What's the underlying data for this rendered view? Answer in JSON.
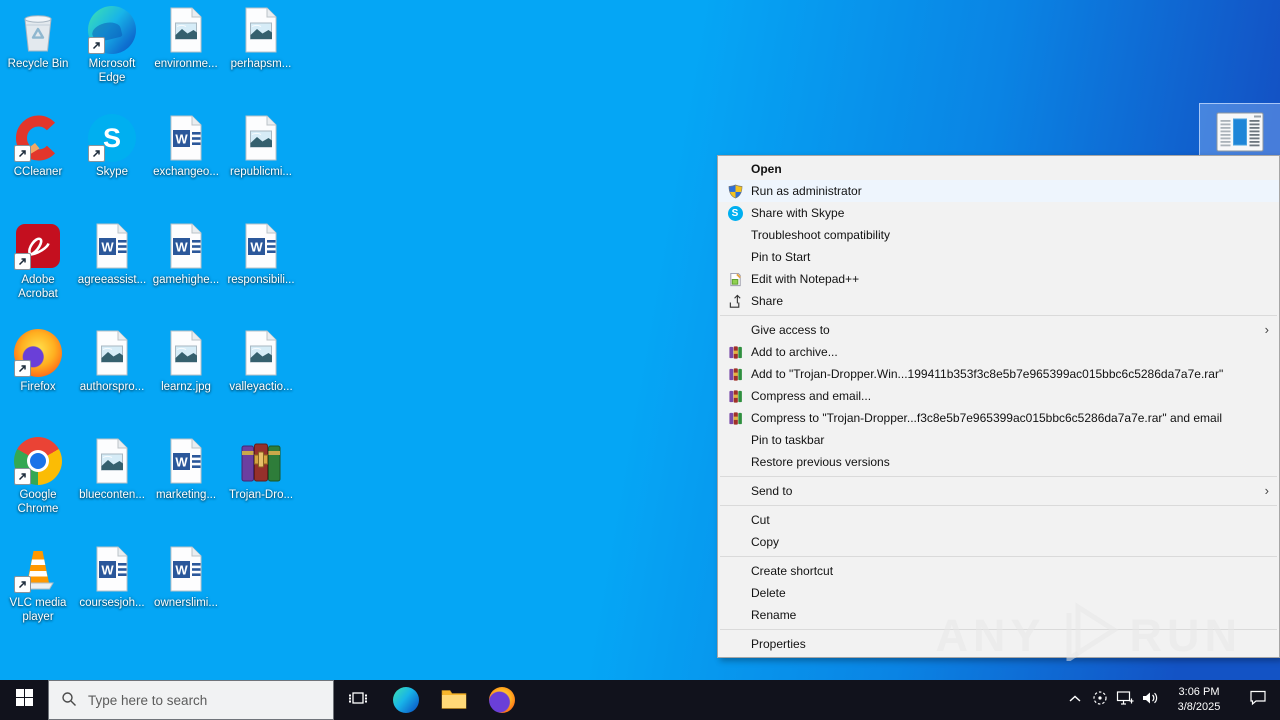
{
  "colors": {
    "wallpaper_left": "#05a6f5",
    "wallpaper_right": "#1353c5",
    "taskbar_bg": "#11121c",
    "menu_bg": "#f2f2f2",
    "menu_highlight": "#eef5fd",
    "selection_highlight": "rgba(150,190,250,0.40)",
    "skype_blue": "#00aff0",
    "word_blue": "#2b579a"
  },
  "desktop": {
    "icons": [
      {
        "label": "Recycle Bin",
        "type": "recycle-bin",
        "col": 0,
        "row": 0,
        "shortcut": false
      },
      {
        "label": "Microsoft Edge",
        "type": "edge",
        "col": 1,
        "row": 0,
        "shortcut": true
      },
      {
        "label": "environme...",
        "type": "image-file",
        "col": 2,
        "row": 0,
        "shortcut": false
      },
      {
        "label": "perhapsm...",
        "type": "image-file",
        "col": 3,
        "row": 0,
        "shortcut": false
      },
      {
        "label": "CCleaner",
        "type": "ccleaner",
        "col": 0,
        "row": 1,
        "shortcut": true
      },
      {
        "label": "Skype",
        "type": "skype",
        "col": 1,
        "row": 1,
        "shortcut": true
      },
      {
        "label": "exchangeo...",
        "type": "word-doc",
        "col": 2,
        "row": 1,
        "shortcut": false
      },
      {
        "label": "republicmi...",
        "type": "image-file",
        "col": 3,
        "row": 1,
        "shortcut": false
      },
      {
        "label": "Adobe Acrobat",
        "type": "acrobat",
        "col": 0,
        "row": 2,
        "shortcut": true
      },
      {
        "label": "agreeassist...",
        "type": "word-doc",
        "col": 1,
        "row": 2,
        "shortcut": false
      },
      {
        "label": "gamehighe...",
        "type": "word-doc",
        "col": 2,
        "row": 2,
        "shortcut": false
      },
      {
        "label": "responsibili...",
        "type": "word-doc",
        "col": 3,
        "row": 2,
        "shortcut": false
      },
      {
        "label": "Firefox",
        "type": "firefox",
        "col": 0,
        "row": 3,
        "shortcut": true
      },
      {
        "label": "authorspro...",
        "type": "image-file",
        "col": 1,
        "row": 3,
        "shortcut": false
      },
      {
        "label": "learnz.jpg",
        "type": "image-file",
        "col": 2,
        "row": 3,
        "shortcut": false
      },
      {
        "label": "valleyactio...",
        "type": "image-file",
        "col": 3,
        "row": 3,
        "shortcut": false
      },
      {
        "label": "Google Chrome",
        "type": "chrome",
        "col": 0,
        "row": 4,
        "shortcut": true
      },
      {
        "label": "blueconten...",
        "type": "image-file",
        "col": 1,
        "row": 4,
        "shortcut": false
      },
      {
        "label": "marketing...",
        "type": "word-doc",
        "col": 2,
        "row": 4,
        "shortcut": false
      },
      {
        "label": "Trojan-Dro...",
        "type": "winrar-archive",
        "col": 3,
        "row": 4,
        "shortcut": false
      },
      {
        "label": "VLC media player",
        "type": "vlc",
        "col": 0,
        "row": 5,
        "shortcut": true
      },
      {
        "label": "coursesjoh...",
        "type": "word-doc",
        "col": 1,
        "row": 5,
        "shortcut": false
      },
      {
        "label": "ownerslimi...",
        "type": "word-doc",
        "col": 2,
        "row": 5,
        "shortcut": false
      }
    ],
    "selected_file": {
      "type": "app-window"
    }
  },
  "context_menu": {
    "items": [
      {
        "label": "Open",
        "bold": true
      },
      {
        "label": "Run as administrator",
        "icon": "uac-shield-icon",
        "highlighted": true
      },
      {
        "label": "Share with Skype",
        "icon": "skype-icon"
      },
      {
        "label": "Troubleshoot compatibility"
      },
      {
        "label": "Pin to Start"
      },
      {
        "label": "Edit with Notepad++",
        "icon": "notepad-icon"
      },
      {
        "label": "Share",
        "icon": "share-icon"
      },
      {
        "separator": true
      },
      {
        "label": "Give access to",
        "submenu": true
      },
      {
        "label": "Add to archive...",
        "icon": "winrar-icon"
      },
      {
        "label": "Add to \"Trojan-Dropper.Win...199411b353f3c8e5b7e965399ac015bbc6c5286da7a7e.rar\"",
        "icon": "winrar-icon"
      },
      {
        "label": "Compress and email...",
        "icon": "winrar-icon"
      },
      {
        "label": "Compress to \"Trojan-Dropper...f3c8e5b7e965399ac015bbc6c5286da7a7e.rar\" and email",
        "icon": "winrar-icon"
      },
      {
        "label": "Pin to taskbar"
      },
      {
        "label": "Restore previous versions"
      },
      {
        "separator": true
      },
      {
        "label": "Send to",
        "submenu": true
      },
      {
        "separator": true
      },
      {
        "label": "Cut"
      },
      {
        "label": "Copy"
      },
      {
        "separator": true
      },
      {
        "label": "Create shortcut"
      },
      {
        "label": "Delete"
      },
      {
        "label": "Rename"
      },
      {
        "separator": true
      },
      {
        "label": "Properties"
      }
    ],
    "submenu_arrow": "›"
  },
  "taskbar": {
    "search_placeholder": "Type here to search",
    "buttons": [
      "task-view",
      "edge",
      "file-explorer",
      "firefox"
    ],
    "tray_icons": [
      "chevron-up",
      "sandbox-agent",
      "network",
      "volume"
    ],
    "clock": {
      "time": "3:06 PM",
      "date": "3/8/2025"
    }
  },
  "watermark": {
    "left": "ANY",
    "right": "RUN"
  }
}
